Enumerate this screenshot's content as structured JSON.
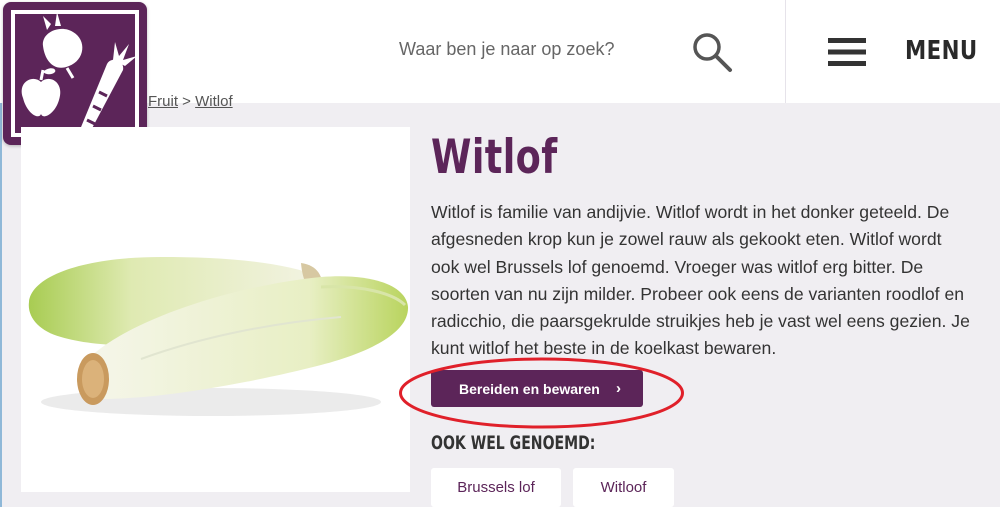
{
  "header": {
    "search_placeholder": "Waar ben je naar op zoek?",
    "menu_label": "MENU"
  },
  "breadcrumb": {
    "parent": "Fruit",
    "separator": ">",
    "current": "Witlof"
  },
  "product": {
    "title": "Witlof",
    "description": "Witlof is familie van andijvie. Witlof wordt in het donker geteeld. De afgesneden krop kun je zowel rauw als gekookt eten. Witlof wordt ook wel Brussels lof genoemd. Vroeger was witlof erg bitter. De soorten van nu zijn milder. Probeer ook eens de varianten roodlof en radicchio, die paarsgekrulde struikjes heb je vast wel eens gezien. Je kunt witlof het beste in de koelkast bewaren.",
    "button_label": "Bereiden en bewaren",
    "button_chevron": "›",
    "aka_heading": "OOK WEL GENOEMD:",
    "aka_tags": [
      "Brussels lof",
      "Witloof"
    ]
  },
  "colors": {
    "brand_purple": "#5c2559",
    "annotation_red": "#e0202a",
    "page_background": "#f0eef2"
  },
  "icons": {
    "logo": "beet-apple-carrot-logo",
    "search": "search-icon",
    "menu": "hamburger-menu-icon"
  }
}
